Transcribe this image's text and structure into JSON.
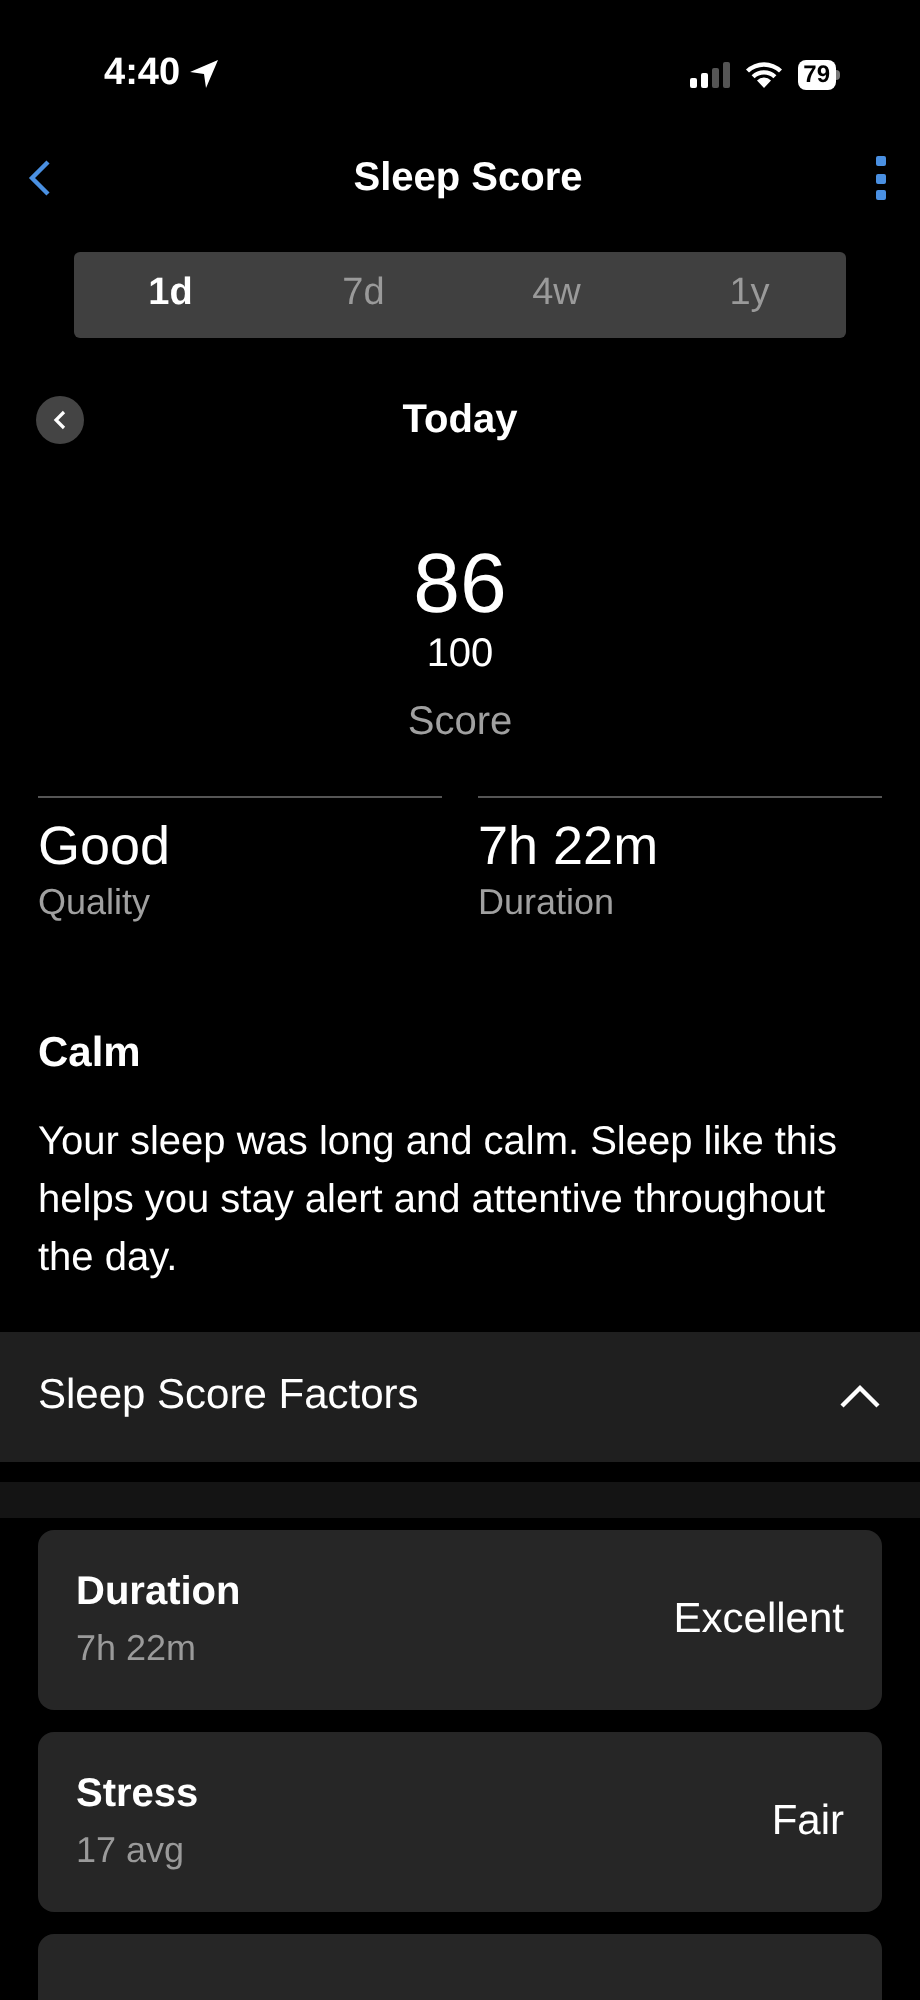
{
  "status_bar": {
    "time": "4:40",
    "battery": "79"
  },
  "nav": {
    "title": "Sleep Score"
  },
  "tabs": [
    {
      "label": "1d",
      "selected": true
    },
    {
      "label": "7d",
      "selected": false
    },
    {
      "label": "4w",
      "selected": false
    },
    {
      "label": "1y",
      "selected": false
    }
  ],
  "date": "Today",
  "score": {
    "value": "86",
    "max": "100",
    "label": "Score"
  },
  "stats": [
    {
      "value": "Good",
      "label": "Quality"
    },
    {
      "value": "7h 22m",
      "label": "Duration"
    }
  ],
  "summary": {
    "title": "Calm",
    "text": "Your sleep was long and calm. Sleep like this helps you stay alert and attentive throughout the day."
  },
  "factors": {
    "title": "Sleep Score Factors",
    "expanded": true,
    "items": [
      {
        "name": "Duration",
        "detail": "7h 22m",
        "rating": "Excellent"
      },
      {
        "name": "Stress",
        "detail": "17 avg",
        "rating": "Fair"
      }
    ]
  }
}
